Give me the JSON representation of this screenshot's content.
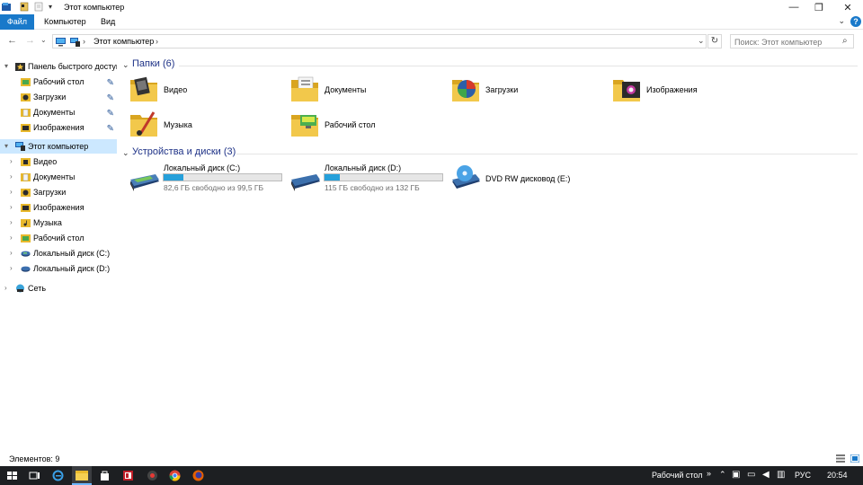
{
  "window": {
    "title": "Этот компьютер",
    "controls": {
      "minimize": "—",
      "restore": "❐",
      "close": "✕"
    }
  },
  "ribbon": {
    "tabs": [
      "Файл",
      "Компьютер",
      "Вид"
    ],
    "help": "?",
    "accent": "#1979ca"
  },
  "address": {
    "crumb": "Этот компьютер",
    "search_placeholder": "Поиск: Этот компьютер"
  },
  "sidebar": {
    "quick_access": "Панель быстрого доступа",
    "quick_items": [
      "Рабочий стол",
      "Загрузки",
      "Документы",
      "Изображения"
    ],
    "this_pc": "Этот компьютер",
    "pc_items": [
      "Видео",
      "Документы",
      "Загрузки",
      "Изображения",
      "Музыка",
      "Рабочий стол",
      "Локальный диск (C:)",
      "Локальный диск (D:)"
    ],
    "network": "Сеть"
  },
  "main": {
    "folders_title": "Папки (6)",
    "folders": [
      "Видео",
      "Документы",
      "Загрузки",
      "Изображения",
      "Музыка",
      "Рабочий стол"
    ],
    "devices_title": "Устройства и диски (3)",
    "drives": [
      {
        "name": "Локальный диск (C:)",
        "free": "82,6 ГБ свободно из 99,5 ГБ",
        "used_fraction": 0.17
      },
      {
        "name": "Локальный диск (D:)",
        "free": "115 ГБ свободно из 132 ГБ",
        "used_fraction": 0.13
      }
    ],
    "dvd": "DVD RW дисковод (E:)"
  },
  "status": {
    "items": "Элементов: 9"
  },
  "taskbar": {
    "desktop_label": "Рабочий стол",
    "chevron": "»",
    "lang": "РУС",
    "time": "20:54"
  }
}
